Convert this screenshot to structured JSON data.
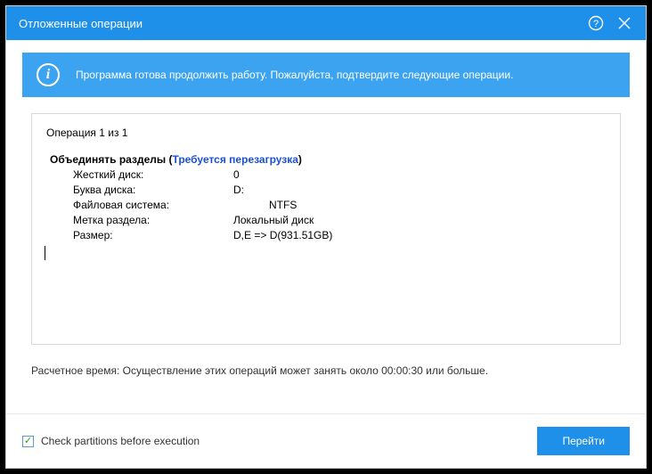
{
  "window": {
    "title": "Отложенные операции"
  },
  "banner": {
    "icon_char": "i",
    "text": "Программа готова продолжить работу. Пожалуйста, подтвердите следующие операции."
  },
  "operations": {
    "counter": "Операция 1 из 1",
    "title": "Объединять разделы ",
    "paren_open": " (",
    "title_link": "Требуется перезагрузка",
    "paren_close": ")",
    "rows": [
      {
        "label": "Жесткий диск:",
        "value": "0"
      },
      {
        "label": "Буква диска:",
        "value": "D:"
      },
      {
        "label": "Файловая система:",
        "value": "NTFS"
      },
      {
        "label": "Метка раздела:",
        "value": "Локальный диск"
      },
      {
        "label": "Размер:",
        "value": "D,E => D(931.51GB)"
      }
    ]
  },
  "estimate": "Расчетное время: Осуществление этих операций может занять около 00:00:30 или больше.",
  "footer": {
    "checkbox_label": "Check partitions before execution",
    "checkbox_checked": true,
    "go_label": "Перейти"
  }
}
